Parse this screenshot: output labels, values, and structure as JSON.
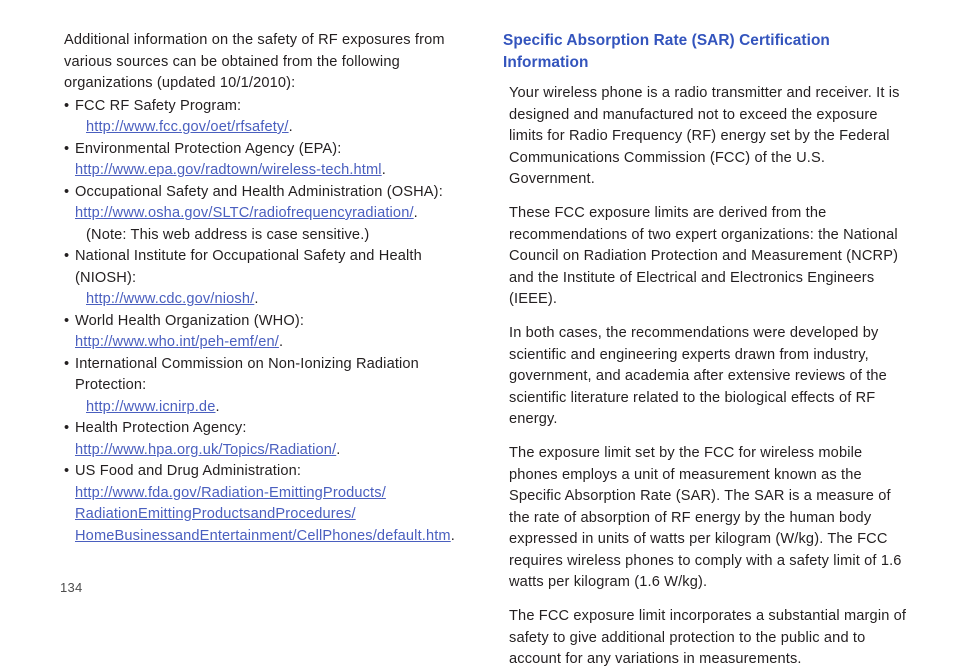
{
  "document": {
    "page_number": "134",
    "colors": {
      "heading_blue": "#3354bd",
      "link_blue": "#4a5fbf",
      "body_text": "#231f20",
      "page_number_gray": "#4d4d4d",
      "background": "#ffffff"
    }
  },
  "left_column": {
    "intro": "Additional information on the safety of RF exposures from various sources can be obtained from the following organizations (updated 10/1/2010):",
    "bullet_char": "•",
    "items": [
      {
        "label": "FCC RF Safety Program:",
        "url": "http://www.fcc.gov/oet/rfsafety/",
        "url_suffix": ".",
        "indent": "b",
        "note": null
      },
      {
        "label": "Environmental Protection Agency (EPA):",
        "url": "http://www.epa.gov/radtown/wireless-tech.html",
        "url_suffix": ".",
        "indent": "a",
        "note": null
      },
      {
        "label": "Occupational Safety and Health Administration (OSHA):",
        "url": "http://www.osha.gov/SLTC/radiofrequencyradiation/",
        "url_suffix": ".",
        "indent": "a",
        "note": "(Note: This web address is case sensitive.)"
      },
      {
        "label": "National Institute for Occupational Safety and Health (NIOSH):",
        "url": "http://www.cdc.gov/niosh/",
        "url_suffix": ".",
        "indent": "b",
        "note": null
      },
      {
        "label": "World Health Organization (WHO):",
        "url": "http://www.who.int/peh-emf/en/",
        "url_suffix": ".",
        "indent": "a",
        "note": null
      },
      {
        "label": "International Commission on Non-Ionizing Radiation Protection:",
        "url": "http://www.icnirp.de",
        "url_suffix": ".",
        "indent": "b",
        "note": null
      },
      {
        "label": "Health Protection Agency:",
        "url": "http://www.hpa.org.uk/Topics/Radiation/",
        "url_suffix": ".",
        "indent": "a",
        "note": null
      },
      {
        "label": "US Food and Drug Administration:",
        "url": "http://www.fda.gov/Radiation-EmittingProducts/",
        "url_line2": "RadiationEmittingProductsandProcedures/",
        "url_line3": "HomeBusinessandEntertainment/CellPhones/default.htm",
        "url_suffix": ".",
        "indent": "a",
        "note": null
      }
    ]
  },
  "right_column": {
    "heading": "Specific Absorption Rate (SAR) Certification Information",
    "paragraphs": [
      "Your wireless phone is a radio transmitter and receiver. It is designed and manufactured not to exceed the exposure limits for Radio Frequency (RF) energy set by the Federal Communications Commission (FCC) of the U.S. Government.",
      "These FCC exposure limits are derived from the recommendations of two expert organizations: the National Council on Radiation Protection and Measurement (NCRP) and the Institute of Electrical and Electronics Engineers (IEEE).",
      "In both cases, the recommendations were developed by scientific and engineering experts drawn from industry, government, and academia after extensive reviews of the scientific literature related to the biological effects of RF energy.",
      "The exposure limit set by the FCC for wireless mobile phones employs a unit of measurement known as the Specific Absorption Rate (SAR). The SAR is a measure of the rate of absorption of RF energy by the human body expressed in units of watts per kilogram (W/kg). The FCC requires wireless phones to comply with a safety limit of 1.6 watts per kilogram (1.6 W/kg).",
      "The FCC exposure limit incorporates a substantial margin of safety to give additional protection to the public and to account for any variations in measurements."
    ]
  }
}
